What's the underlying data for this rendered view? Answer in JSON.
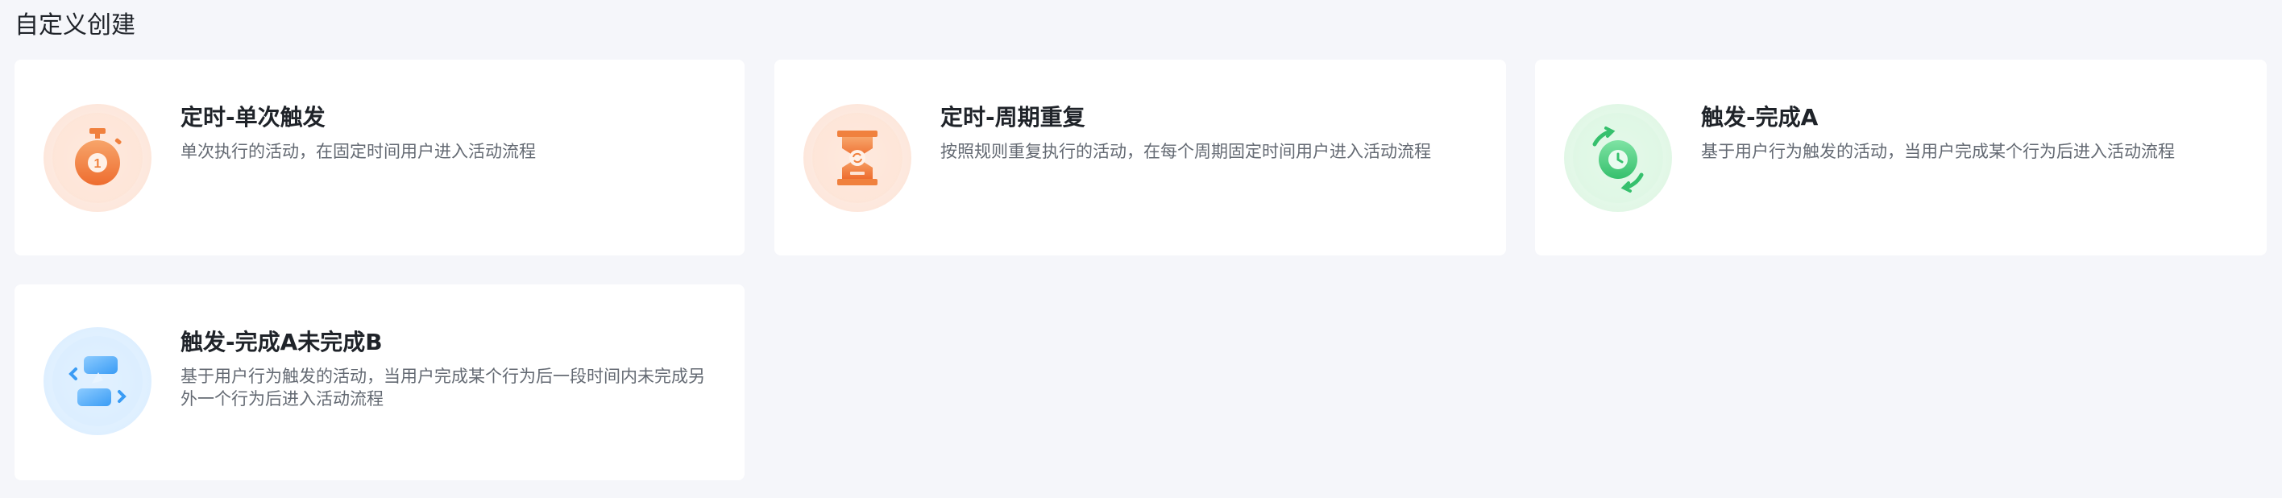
{
  "page_title": "自定义创建",
  "cards": [
    {
      "title": "定时-单次触发",
      "desc": "单次执行的活动，在固定时间用户进入活动流程",
      "icon": "stopwatch-icon",
      "icon_number": "1",
      "accent": "#f0813e"
    },
    {
      "title": "定时-周期重复",
      "desc": "按照规则重复执行的活动，在每个周期固定时间用户进入活动流程",
      "icon": "hourglass-icon",
      "accent": "#f0813e"
    },
    {
      "title": "触发-完成A",
      "desc": "基于用户行为触发的活动，当用户完成某个行为后进入活动流程",
      "icon": "clock-cycle-icon",
      "accent": "#3fcf7c"
    },
    {
      "title": "触发-完成A未完成B",
      "desc": "基于用户行为触发的活动，当用户完成某个行为后一段时间内未完成另外一个行为后进入活动流程",
      "icon": "branch-flow-icon",
      "accent": "#3a9cf5"
    }
  ]
}
